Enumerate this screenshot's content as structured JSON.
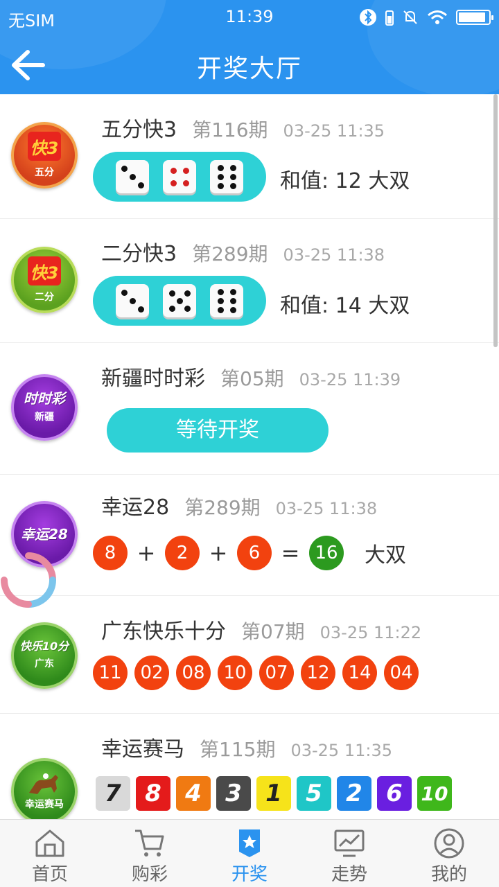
{
  "status_bar": {
    "carrier": "无SIM",
    "time": "11:39"
  },
  "header": {
    "title": "开奖大厅"
  },
  "colors": {
    "brand": "#2b93ef",
    "pill": "#2ed1d6",
    "ball_red": "#f2420f",
    "ball_green": "#2c9a1f"
  },
  "lotteries": [
    {
      "name": "五分快3",
      "issue": "第116期",
      "time": "03-25 11:35",
      "logo_main": "快3",
      "logo_sub": "五分",
      "dice": [
        3,
        4,
        6
      ],
      "result": "和值: 12  大双"
    },
    {
      "name": "二分快3",
      "issue": "第289期",
      "time": "03-25 11:38",
      "logo_main": "快3",
      "logo_sub": "二分",
      "dice": [
        3,
        5,
        6
      ],
      "result": "和值: 14  大双"
    },
    {
      "name": "新疆时时彩",
      "issue": "第05期",
      "time": "03-25 11:39",
      "logo_main": "时时彩",
      "logo_sub": "新疆",
      "waiting_label": "等待开奖"
    },
    {
      "name": "幸运28",
      "issue": "第289期",
      "time": "03-25 11:38",
      "logo_main": "幸运28",
      "balls": [
        "8",
        "2",
        "6"
      ],
      "ops": [
        "+",
        "+",
        "="
      ],
      "sum": "16",
      "result": "大双"
    },
    {
      "name": "广东快乐十分",
      "issue": "第07期",
      "time": "03-25 11:22",
      "logo_main": "快乐10分",
      "logo_sub": "广东",
      "balls": [
        "11",
        "02",
        "08",
        "10",
        "07",
        "12",
        "14",
        "04"
      ]
    },
    {
      "name": "幸运赛马",
      "issue": "第115期",
      "time": "03-25 11:35",
      "logo_sub": "幸运赛马",
      "squares": [
        {
          "n": "7",
          "bg": "#d9d9d9",
          "fg": "#222222"
        },
        {
          "n": "8",
          "bg": "#e41b1b",
          "fg": "#ffffff"
        },
        {
          "n": "4",
          "bg": "#f07a12",
          "fg": "#ffffff"
        },
        {
          "n": "3",
          "bg": "#4a4a4a",
          "fg": "#ffffff"
        },
        {
          "n": "1",
          "bg": "#f6e31a",
          "fg": "#222222"
        },
        {
          "n": "5",
          "bg": "#1fc6c7",
          "fg": "#ffffff"
        },
        {
          "n": "2",
          "bg": "#2186e8",
          "fg": "#ffffff"
        },
        {
          "n": "6",
          "bg": "#6a1fe0",
          "fg": "#ffffff"
        },
        {
          "n": "10",
          "bg": "#3fb71b",
          "fg": "#ffffff"
        }
      ]
    }
  ],
  "tabs": [
    {
      "label": "首页",
      "icon": "home-icon"
    },
    {
      "label": "购彩",
      "icon": "cart-icon"
    },
    {
      "label": "开奖",
      "icon": "award-icon",
      "active": true
    },
    {
      "label": "走势",
      "icon": "trend-icon"
    },
    {
      "label": "我的",
      "icon": "user-icon"
    }
  ]
}
